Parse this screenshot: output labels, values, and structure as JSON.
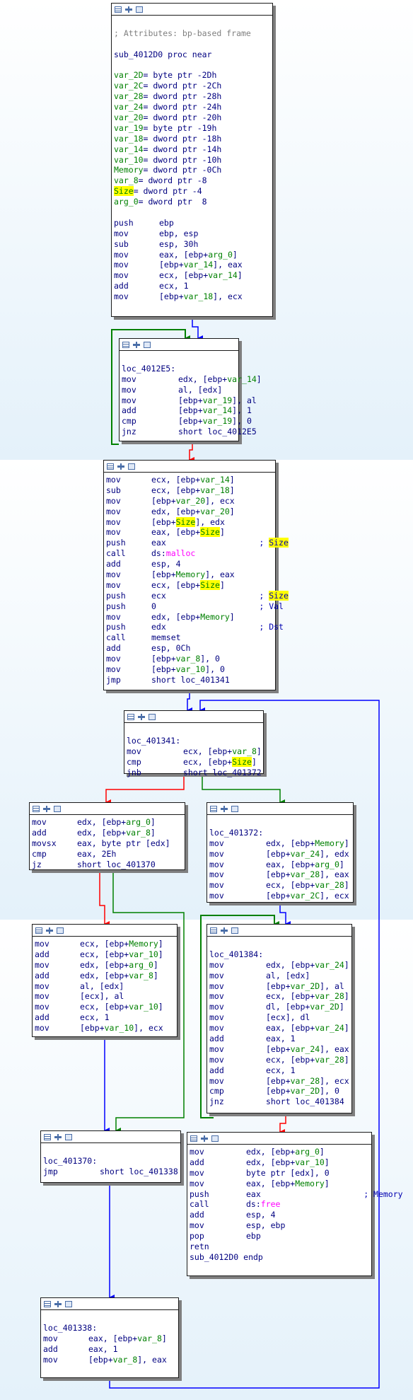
{
  "blocks": {
    "b0": {
      "lines": [
        {
          "t": ""
        },
        {
          "t": "; Attributes: bp-based frame",
          "cls": "gray"
        },
        {
          "t": ""
        },
        {
          "t": "sub_4012D0 proc near"
        },
        {
          "t": ""
        },
        {
          "v": "var_2D",
          "d": "= byte ptr -2Dh"
        },
        {
          "v": "var_2C",
          "d": "= dword ptr -2Ch"
        },
        {
          "v": "var_28",
          "d": "= dword ptr -28h"
        },
        {
          "v": "var_24",
          "d": "= dword ptr -24h"
        },
        {
          "v": "var_20",
          "d": "= dword ptr -20h"
        },
        {
          "v": "var_19",
          "d": "= byte ptr -19h"
        },
        {
          "v": "var_18",
          "d": "= dword ptr -18h"
        },
        {
          "v": "var_14",
          "d": "= dword ptr -14h"
        },
        {
          "v": "var_10",
          "d": "= dword ptr -10h"
        },
        {
          "v": "Memory",
          "d": "= dword ptr -0Ch"
        },
        {
          "v": "var_8",
          "d": "= dword ptr -8"
        },
        {
          "v": "Size",
          "d": "= dword ptr -4",
          "hl": true
        },
        {
          "v": "arg_0",
          "d": "= dword ptr  8"
        },
        {
          "t": ""
        },
        {
          "m": "push",
          "o": "ebp"
        },
        {
          "m": "mov",
          "o": "ebp, esp"
        },
        {
          "m": "sub",
          "o": "esp, 30h"
        },
        {
          "m": "mov",
          "o": "eax, [ebp+arg_0]"
        },
        {
          "m": "mov",
          "o": "[ebp+var_14], eax"
        },
        {
          "m": "mov",
          "o": "ecx, [ebp+var_14]"
        },
        {
          "m": "add",
          "o": "ecx, 1"
        },
        {
          "m": "mov",
          "o": "[ebp+var_18], ecx"
        }
      ]
    },
    "b1": {
      "lines": [
        {
          "t": ""
        },
        {
          "t": "loc_4012E5:"
        },
        {
          "m": "mov",
          "o": "edx, [ebp+var_14]"
        },
        {
          "m": "mov",
          "o": "al, [edx]"
        },
        {
          "m": "mov",
          "o": "[ebp+var_19], al"
        },
        {
          "m": "add",
          "o": "[ebp+var_14], 1"
        },
        {
          "m": "cmp",
          "o": "[ebp+var_19], 0"
        },
        {
          "m": "jnz",
          "o": "short loc_4012E5"
        }
      ]
    },
    "b2": {
      "lines": [
        {
          "m": "mov",
          "o": "ecx, [ebp+var_14]"
        },
        {
          "m": "sub",
          "o": "ecx, [ebp+var_18]"
        },
        {
          "m": "mov",
          "o": "[ebp+var_20], ecx"
        },
        {
          "m": "mov",
          "o": "edx, [ebp+var_20]"
        },
        {
          "m": "mov",
          "o": "[ebp+Size], edx"
        },
        {
          "m": "mov",
          "o": "eax, [ebp+Size]"
        },
        {
          "m": "push",
          "o": "eax",
          "c": "; Size"
        },
        {
          "m": "call",
          "o": "ds:malloc"
        },
        {
          "m": "add",
          "o": "esp, 4"
        },
        {
          "m": "mov",
          "o": "[ebp+Memory], eax"
        },
        {
          "m": "mov",
          "o": "ecx, [ebp+Size]"
        },
        {
          "m": "push",
          "o": "ecx",
          "c": "; Size"
        },
        {
          "m": "push",
          "o": "0",
          "c": "; Val"
        },
        {
          "m": "mov",
          "o": "edx, [ebp+Memory]"
        },
        {
          "m": "push",
          "o": "edx",
          "c": "; Dst"
        },
        {
          "m": "call",
          "o": "memset"
        },
        {
          "m": "add",
          "o": "esp, 0Ch"
        },
        {
          "m": "mov",
          "o": "[ebp+var_8], 0"
        },
        {
          "m": "mov",
          "o": "[ebp+var_10], 0"
        },
        {
          "m": "jmp",
          "o": "short loc_401341"
        }
      ]
    },
    "b3": {
      "lines": [
        {
          "t": ""
        },
        {
          "t": "loc_401341:"
        },
        {
          "m": "mov",
          "o": "ecx, [ebp+var_8]"
        },
        {
          "m": "cmp",
          "o": "ecx, [ebp+Size]"
        },
        {
          "m": "jnb",
          "o": "short loc_401372"
        }
      ]
    },
    "b4": {
      "lines": [
        {
          "m": "mov",
          "o": "edx, [ebp+arg_0]"
        },
        {
          "m": "add",
          "o": "edx, [ebp+var_8]"
        },
        {
          "m": "movsx",
          "o": "eax, byte ptr [edx]"
        },
        {
          "m": "cmp",
          "o": "eax, 2Eh"
        },
        {
          "m": "jz",
          "o": "short loc_401370"
        }
      ]
    },
    "b5": {
      "lines": [
        {
          "t": ""
        },
        {
          "t": "loc_401372:"
        },
        {
          "m": "mov",
          "o": "edx, [ebp+Memory]"
        },
        {
          "m": "mov",
          "o": "[ebp+var_24], edx"
        },
        {
          "m": "mov",
          "o": "eax, [ebp+arg_0]"
        },
        {
          "m": "mov",
          "o": "[ebp+var_28], eax"
        },
        {
          "m": "mov",
          "o": "ecx, [ebp+var_28]"
        },
        {
          "m": "mov",
          "o": "[ebp+var_2C], ecx"
        }
      ]
    },
    "b6": {
      "lines": [
        {
          "m": "mov",
          "o": "ecx, [ebp+Memory]"
        },
        {
          "m": "add",
          "o": "ecx, [ebp+var_10]"
        },
        {
          "m": "mov",
          "o": "edx, [ebp+arg_0]"
        },
        {
          "m": "add",
          "o": "edx, [ebp+var_8]"
        },
        {
          "m": "mov",
          "o": "al, [edx]"
        },
        {
          "m": "mov",
          "o": "[ecx], al"
        },
        {
          "m": "mov",
          "o": "ecx, [ebp+var_10]"
        },
        {
          "m": "add",
          "o": "ecx, 1"
        },
        {
          "m": "mov",
          "o": "[ebp+var_10], ecx"
        }
      ]
    },
    "b7": {
      "lines": [
        {
          "t": ""
        },
        {
          "t": "loc_401384:"
        },
        {
          "m": "mov",
          "o": "edx, [ebp+var_24]"
        },
        {
          "m": "mov",
          "o": "al, [edx]"
        },
        {
          "m": "mov",
          "o": "[ebp+var_2D], al"
        },
        {
          "m": "mov",
          "o": "ecx, [ebp+var_28]"
        },
        {
          "m": "mov",
          "o": "dl, [ebp+var_2D]"
        },
        {
          "m": "mov",
          "o": "[ecx], dl"
        },
        {
          "m": "mov",
          "o": "eax, [ebp+var_24]"
        },
        {
          "m": "add",
          "o": "eax, 1"
        },
        {
          "m": "mov",
          "o": "[ebp+var_24], eax"
        },
        {
          "m": "mov",
          "o": "ecx, [ebp+var_28]"
        },
        {
          "m": "add",
          "o": "ecx, 1"
        },
        {
          "m": "mov",
          "o": "[ebp+var_28], ecx"
        },
        {
          "m": "cmp",
          "o": "[ebp+var_2D], 0"
        },
        {
          "m": "jnz",
          "o": "short loc_401384"
        }
      ]
    },
    "b8": {
      "lines": [
        {
          "t": ""
        },
        {
          "t": "loc_401370:"
        },
        {
          "m": "jmp",
          "o": "short loc_401338"
        }
      ]
    },
    "b9": {
      "lines": [
        {
          "m": "mov",
          "o": "edx, [ebp+arg_0]"
        },
        {
          "m": "add",
          "o": "edx, [ebp+var_10]"
        },
        {
          "m": "mov",
          "o": "byte ptr [edx], 0"
        },
        {
          "m": "mov",
          "o": "eax, [ebp+Memory]"
        },
        {
          "m": "push",
          "o": "eax",
          "c": "; Memory"
        },
        {
          "m": "call",
          "o": "ds:free"
        },
        {
          "m": "add",
          "o": "esp, 4"
        },
        {
          "m": "mov",
          "o": "esp, ebp"
        },
        {
          "m": "pop",
          "o": "ebp"
        },
        {
          "m": "retn",
          "o": ""
        },
        {
          "t": "sub_4012D0 endp"
        }
      ]
    },
    "b10": {
      "lines": [
        {
          "t": ""
        },
        {
          "t": "loc_401338:"
        },
        {
          "m": "mov",
          "o": "eax, [ebp+var_8]"
        },
        {
          "m": "add",
          "o": "eax, 1"
        },
        {
          "m": "mov",
          "o": "[ebp+var_8], eax"
        }
      ]
    }
  },
  "colors": {
    "true_branch": "#008000",
    "false_branch": "#ff0000",
    "unconditional": "#0000ff",
    "band_light": "#eaf4fb",
    "band_mid": "#dcecf7"
  }
}
